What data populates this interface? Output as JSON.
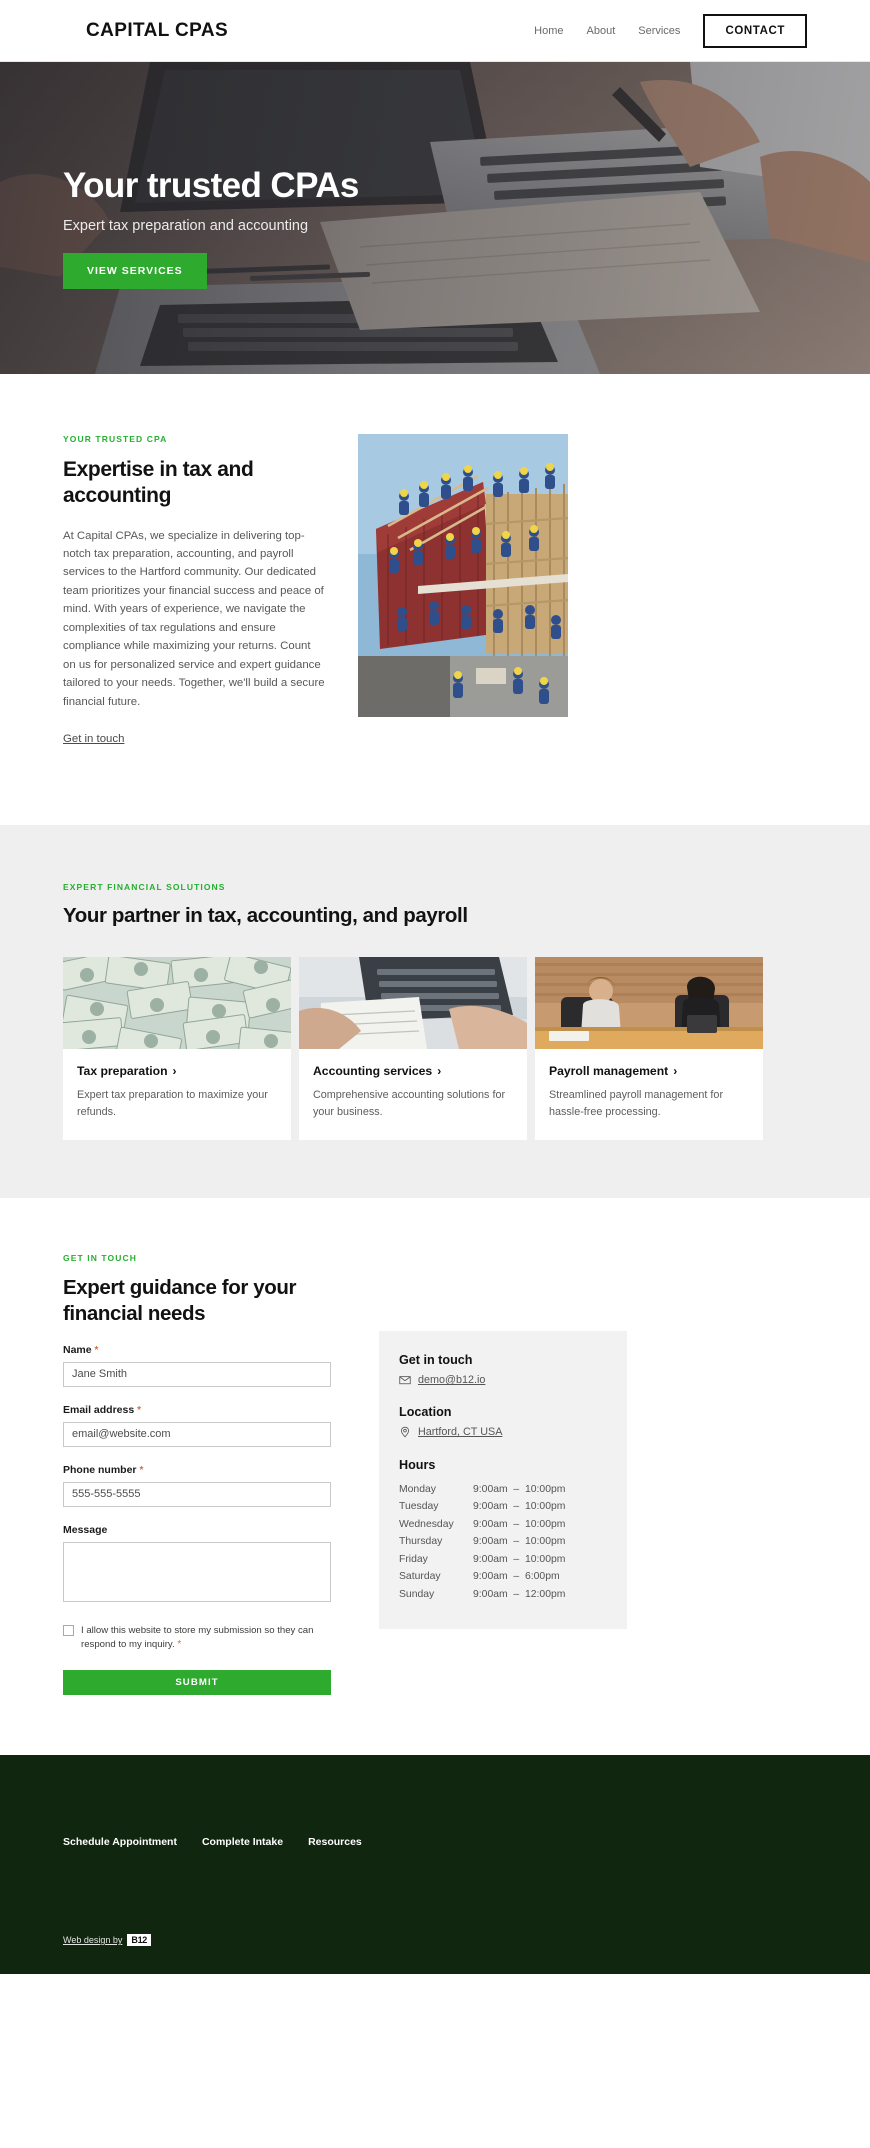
{
  "header": {
    "brand": "CAPITAL CPAS",
    "nav": [
      {
        "label": "Home",
        "name": "nav-home"
      },
      {
        "label": "About",
        "name": "nav-about"
      },
      {
        "label": "Services",
        "name": "nav-services"
      }
    ],
    "cta_label": "CONTACT"
  },
  "hero": {
    "title": "Your trusted CPAs",
    "subtitle": "Expert tax preparation and accounting",
    "button_label": "VIEW SERVICES"
  },
  "about": {
    "eyebrow": "YOUR TRUSTED CPA",
    "heading": "Expertise in tax and accounting",
    "paragraph": "At Capital CPAs, we specialize in delivering top-notch tax preparation, accounting, and payroll services to the Hartford community. Our dedicated team prioritizes your financial success and peace of mind. With years of experience, we navigate the complexities of tax regulations and ensure compliance while maximizing your returns. Count on us for personalized service and expert guidance tailored to your needs. Together, we'll build a secure financial future.",
    "link_label": "Get in touch",
    "image_alt": "construction-framing-photo"
  },
  "services": {
    "eyebrow": "EXPERT FINANCIAL SOLUTIONS",
    "heading": "Your partner in tax, accounting, and payroll",
    "chevron": "›",
    "cards": [
      {
        "title": "Tax preparation",
        "desc": "Expert tax preparation to maximize your refunds.",
        "image_alt": "cash-money-photo"
      },
      {
        "title": "Accounting services",
        "desc": "Comprehensive accounting solutions for your business.",
        "image_alt": "laptop-paperwork-photo"
      },
      {
        "title": "Payroll management",
        "desc": "Streamlined payroll management for hassle-free processing.",
        "image_alt": "two-women-meeting-photo"
      }
    ]
  },
  "contact": {
    "eyebrow": "GET IN TOUCH",
    "heading": "Expert guidance for your financial needs",
    "form": {
      "name_label": "Name",
      "name_value": "Jane Smith",
      "email_label": "Email address",
      "email_value": "email@website.com",
      "phone_label": "Phone number",
      "phone_value": "555-555-5555",
      "message_label": "Message",
      "message_value": "",
      "required_mark": "*",
      "consent_text": "I allow this website to store my submission so they can respond to my inquiry.",
      "submit_label": "SUBMIT"
    },
    "info": {
      "get_in_touch_label": "Get in touch",
      "email": "demo@b12.io",
      "location_label": "Location",
      "location": "Hartford, CT USA",
      "hours_label": "Hours",
      "hours": [
        {
          "day": "Monday",
          "time": "9:00am  –  10:00pm"
        },
        {
          "day": "Tuesday",
          "time": "9:00am  –  10:00pm"
        },
        {
          "day": "Wednesday",
          "time": "9:00am  –  10:00pm"
        },
        {
          "day": "Thursday",
          "time": "9:00am  –  10:00pm"
        },
        {
          "day": "Friday",
          "time": "9:00am  –  10:00pm"
        },
        {
          "day": "Saturday",
          "time": "9:00am  –  6:00pm"
        },
        {
          "day": "Sunday",
          "time": "9:00am  –  12:00pm"
        }
      ]
    }
  },
  "footer": {
    "links": [
      {
        "label": "Schedule Appointment"
      },
      {
        "label": "Complete Intake"
      },
      {
        "label": "Resources"
      }
    ],
    "credit_text": "Web design by",
    "credit_brand": "B12"
  },
  "colors": {
    "accent_green": "#2eab2e",
    "eyebrow_green": "#25b02f",
    "footer_dark": "#11260f",
    "section_gray": "#efefef",
    "info_gray": "#f2f2f2",
    "required": "#d4703c"
  }
}
